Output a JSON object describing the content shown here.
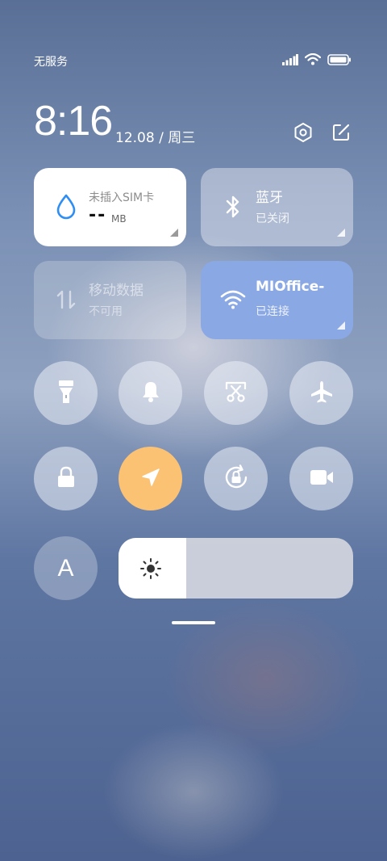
{
  "status": {
    "carrier": "无服务"
  },
  "header": {
    "time": "8:16",
    "date": "12.08 / 周三"
  },
  "tiles": {
    "data": {
      "title": "未插入SIM卡",
      "value": "--",
      "unit": "MB"
    },
    "bluetooth": {
      "title": "蓝牙",
      "status": "已关闭"
    },
    "mobile_data": {
      "title": "移动数据",
      "status": "不可用"
    },
    "wifi": {
      "title": "MIOffice-",
      "status": "已连接"
    }
  },
  "toggles": {
    "font_button_label": "A"
  },
  "brightness": {
    "level": 0.29
  },
  "colors": {
    "accent_wifi": "#8aa8e3",
    "location_active": "#fcc274",
    "water_blue": "#2f8ef4"
  },
  "icons": [
    "signal-icon",
    "wifi-icon",
    "battery-icon",
    "settings-icon",
    "edit-icon",
    "water-drop-icon",
    "bluetooth-icon",
    "mobile-data-icon",
    "flashlight-icon",
    "bell-icon",
    "screenshot-icon",
    "airplane-icon",
    "lock-icon",
    "location-icon",
    "rotation-lock-icon",
    "video-icon",
    "brightness-icon"
  ]
}
